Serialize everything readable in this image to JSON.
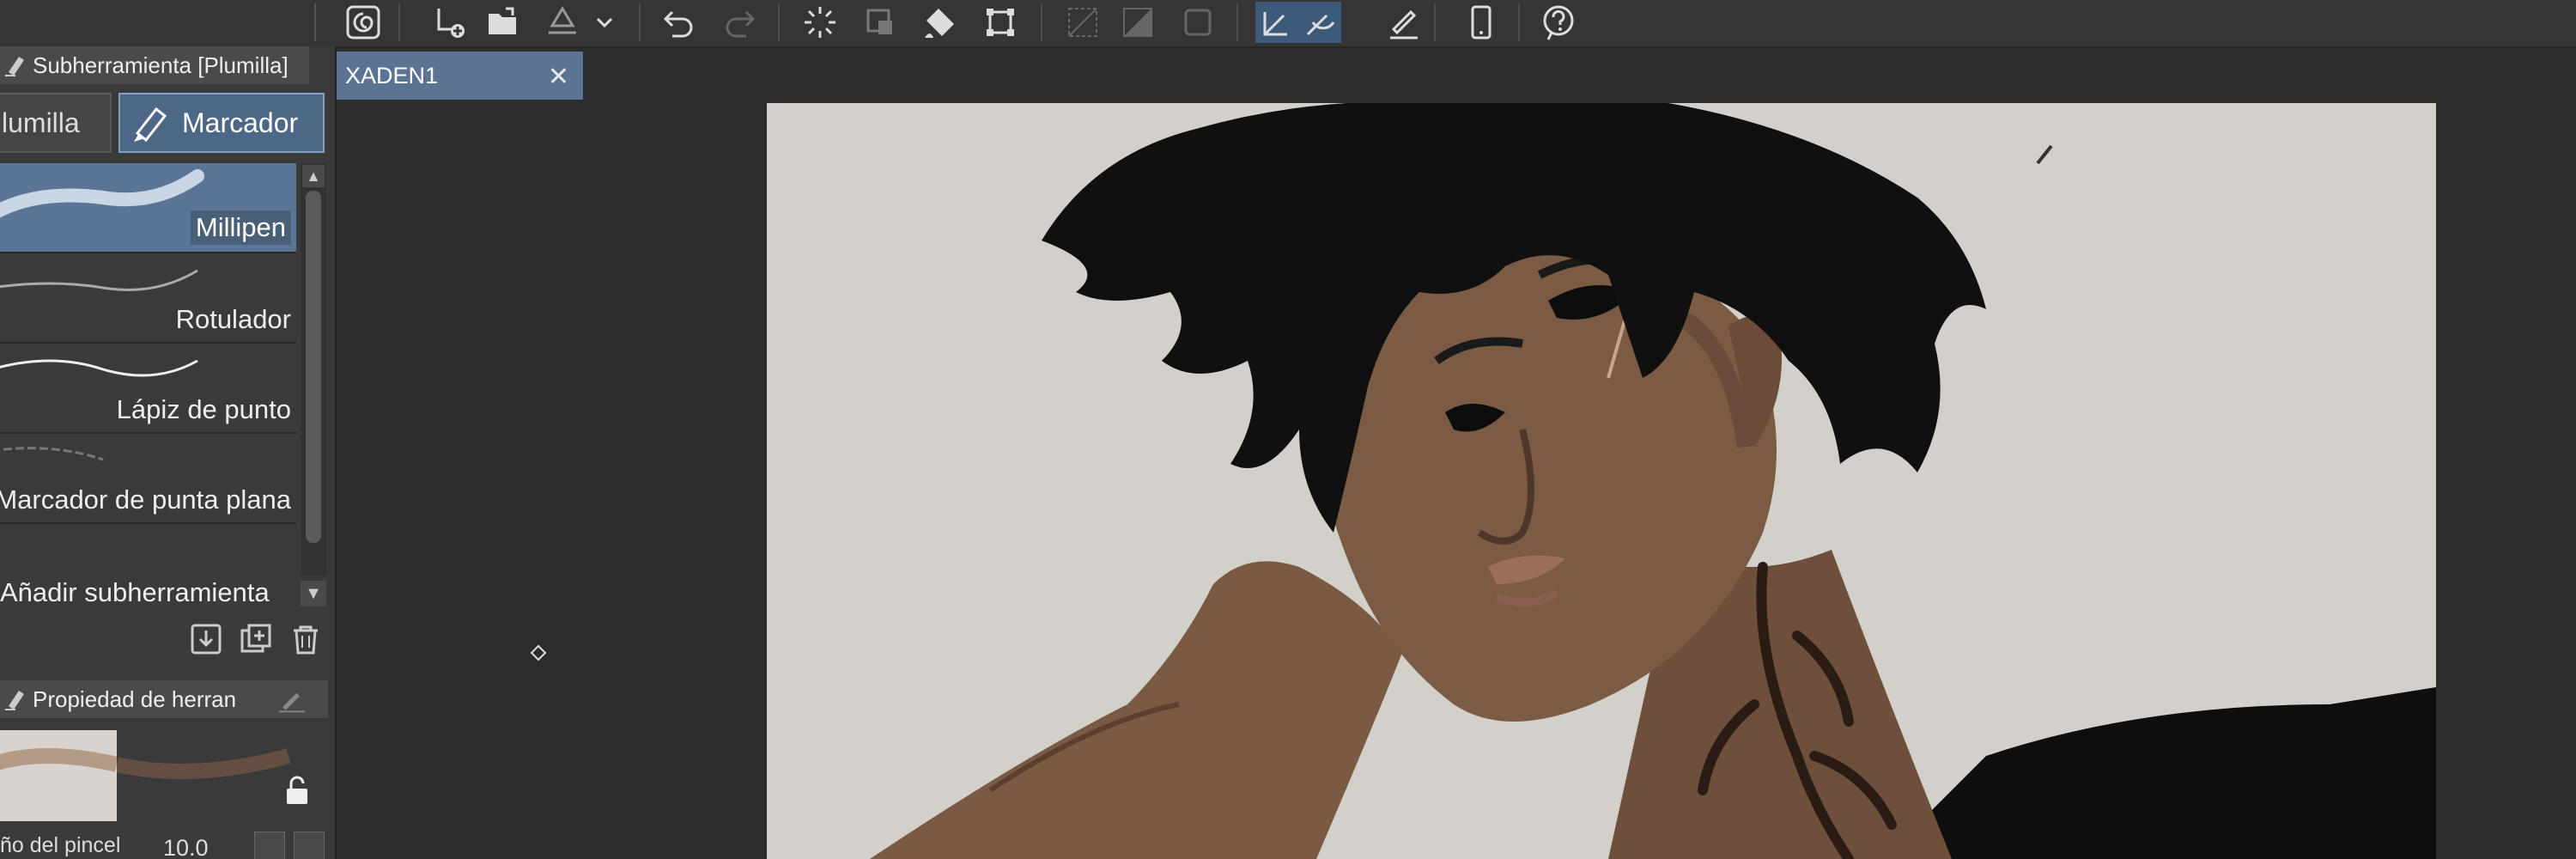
{
  "document": {
    "tab_label": "XADEN1",
    "tab_close": "✕"
  },
  "toolbar": {
    "icons": [
      "app-logo-icon",
      "new-layer-icon",
      "open-file-icon",
      "export-icon",
      "dropdown-icon",
      "undo-icon",
      "redo-icon",
      "loading-icon",
      "transform-icon",
      "fill-icon",
      "crop-icon",
      "deselect-icon",
      "invert-selection-icon",
      "selection-icon",
      "snap-icon",
      "ruler-snap-icon",
      "pen-pressure-icon",
      "mobile-icon",
      "help-icon"
    ]
  },
  "subtool_panel": {
    "title": "Subherramienta [Plumilla]",
    "tabs": [
      {
        "label": "lumilla",
        "active": false
      },
      {
        "label": "Marcador",
        "active": true
      }
    ],
    "brushes": [
      {
        "name": "Millipen",
        "selected": true
      },
      {
        "name": "Rotulador",
        "selected": false
      },
      {
        "name": "Lápiz de punto",
        "selected": false
      },
      {
        "name": "Marcador de punta plana",
        "selected": false
      }
    ],
    "add_label": "Añadir subherramienta"
  },
  "property_panel": {
    "title": "Propiedad de herran",
    "brush_size_label": "ño del pincel",
    "brush_size_value": "10.0"
  },
  "colors": {
    "accent": "#5c7493",
    "panel_bg": "#3a3a3a",
    "canvas_bg": "#d3cfcb",
    "skin": "#7a5a43",
    "hair": "#111111"
  }
}
